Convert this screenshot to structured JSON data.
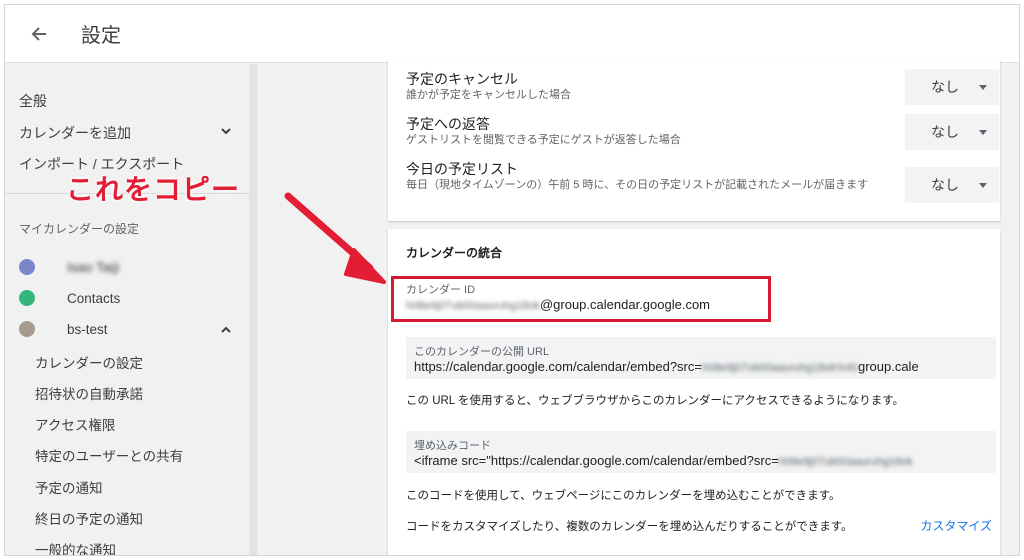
{
  "header": {
    "title": "設定"
  },
  "sidebar": {
    "items": [
      {
        "label": "全般"
      },
      {
        "label": "カレンダーを追加"
      },
      {
        "label": "インポート / エクスポート"
      }
    ],
    "section_title": "マイカレンダーの設定",
    "calendars": [
      {
        "name": "Isao Taiji",
        "color": "#7986cb"
      },
      {
        "name": "Contacts",
        "color": "#33b679"
      },
      {
        "name": "bs-test",
        "color": "#a79b8e"
      }
    ],
    "sub_items": [
      {
        "label": "カレンダーの設定"
      },
      {
        "label": "招待状の自動承諾"
      },
      {
        "label": "アクセス権限"
      },
      {
        "label": "特定のユーザーとの共有"
      },
      {
        "label": "予定の通知"
      },
      {
        "label": "終日の予定の通知"
      },
      {
        "label": "一般的な通知"
      }
    ]
  },
  "notifications": {
    "rows": [
      {
        "label": "予定のキャンセル",
        "desc": "誰かが予定をキャンセルした場合",
        "value": "なし"
      },
      {
        "label": "予定への返答",
        "desc": "ゲストリストを閲覧できる予定にゲストが返答した場合",
        "value": "なし"
      },
      {
        "label": "今日の予定リスト",
        "desc": "毎日（現地タイムゾーンの）午前 5 時に、その日の予定リストが記載されたメールが届きます",
        "value": "なし"
      }
    ]
  },
  "integration": {
    "title": "カレンダーの統合",
    "calendar_id_label": "カレンダー ID",
    "calendar_id_blur": "h08e9j07ub00aauruhg18ok",
    "calendar_id_suffix": "@group.calendar.google.com",
    "public_url_label": "このカレンダーの公開 URL",
    "public_url_prefix": "https://calendar.google.com/calendar/embed?src=",
    "public_url_blur": "h08e9j07ub00aauruhg18ok%40",
    "public_url_suffix": "group.cale",
    "public_url_note": "この URL を使用すると、ウェブブラウザからこのカレンダーにアクセスできるようになります。",
    "embed_label": "埋め込みコード",
    "embed_prefix": "<iframe src=\"https://calendar.google.com/calendar/embed?src=",
    "embed_blur": "h08e9j07ub00aauruhg18ok",
    "embed_note": "このコードを使用して、ウェブページにこのカレンダーを埋め込むことができます。",
    "customize_note": "コードをカスタマイズしたり、複数のカレンダーを埋め込んだりすることができます。",
    "customize_link": "カスタマイズ"
  },
  "annotation": {
    "text": "これをコピー"
  },
  "colors": {
    "accent": "#1a73e8",
    "annotation": "#e31d34"
  }
}
